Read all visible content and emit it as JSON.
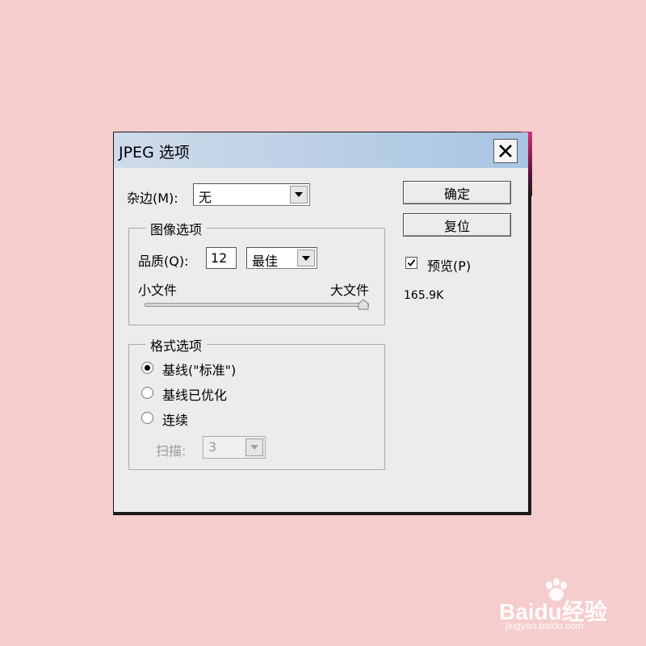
{
  "dialog": {
    "title": "JPEG 选项",
    "matte": {
      "label": "杂边(M):",
      "value": "无"
    },
    "image_options": {
      "title": "图像选项",
      "quality_label": "品质(Q):",
      "quality_value": "12",
      "quality_preset": "最佳",
      "small_file_label": "小文件",
      "large_file_label": "大文件",
      "slider_level": 1.0
    },
    "format_options": {
      "title": "格式选项",
      "options": [
        {
          "label": "基线(\"标准\")",
          "selected": true
        },
        {
          "label": "基线已优化",
          "selected": false
        },
        {
          "label": "连续",
          "selected": false
        }
      ],
      "scans_label": "扫描:",
      "scans_value": "3"
    },
    "buttons": {
      "ok": "确定",
      "reset": "复位"
    },
    "preview": {
      "label": "预览(P)",
      "checked": true
    },
    "file_size": "165.9K"
  },
  "watermark": {
    "text": "Baidu经验",
    "sub": "jingyan.baidu.com"
  }
}
